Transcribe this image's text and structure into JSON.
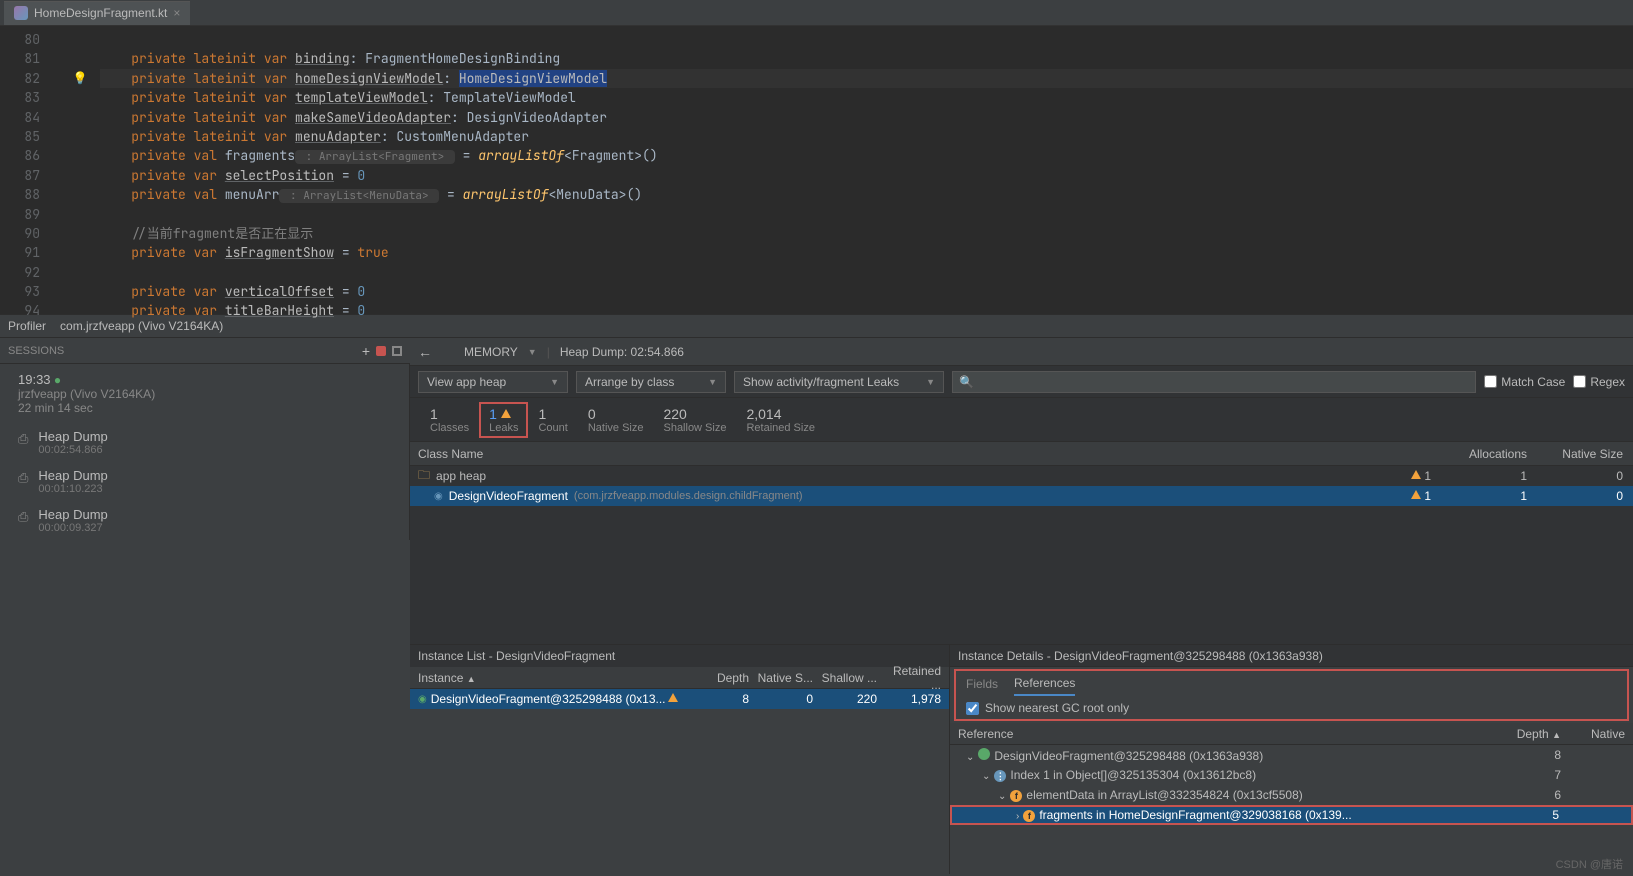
{
  "tab": {
    "filename": "HomeDesignFragment.kt"
  },
  "gutter_start": 80,
  "code_lines": [
    {
      "n": 80,
      "segs": []
    },
    {
      "n": 81,
      "segs": [
        [
          "    ",
          ""
        ],
        [
          "private ",
          "kw"
        ],
        [
          "lateinit ",
          "kw"
        ],
        [
          "var ",
          "kw"
        ],
        [
          "binding",
          "under"
        ],
        [
          ": FragmentHomeDesignBinding",
          "type"
        ]
      ]
    },
    {
      "n": 82,
      "bulb": true,
      "hl": true,
      "segs": [
        [
          "    ",
          ""
        ],
        [
          "private ",
          "kw"
        ],
        [
          "lateinit ",
          "kw"
        ],
        [
          "var ",
          "kw"
        ],
        [
          "homeDesignViewModel",
          "under"
        ],
        [
          ": ",
          "type"
        ],
        [
          "HomeDesignViewModel",
          "caret-sel"
        ]
      ]
    },
    {
      "n": 83,
      "segs": [
        [
          "    ",
          ""
        ],
        [
          "private ",
          "kw"
        ],
        [
          "lateinit ",
          "kw"
        ],
        [
          "var ",
          "kw"
        ],
        [
          "templateViewModel",
          "under"
        ],
        [
          ": TemplateViewModel",
          "type"
        ]
      ]
    },
    {
      "n": 84,
      "segs": [
        [
          "    ",
          ""
        ],
        [
          "private ",
          "kw"
        ],
        [
          "lateinit ",
          "kw"
        ],
        [
          "var ",
          "kw"
        ],
        [
          "makeSameVideoAdapter",
          "under"
        ],
        [
          ": DesignVideoAdapter",
          "type"
        ]
      ]
    },
    {
      "n": 85,
      "segs": [
        [
          "    ",
          ""
        ],
        [
          "private ",
          "kw"
        ],
        [
          "lateinit ",
          "kw"
        ],
        [
          "var ",
          "kw"
        ],
        [
          "menuAdapter",
          "under"
        ],
        [
          ": CustomMenuAdapter",
          "type"
        ]
      ]
    },
    {
      "n": 86,
      "segs": [
        [
          "    ",
          ""
        ],
        [
          "private ",
          "kw"
        ],
        [
          "val ",
          "kw"
        ],
        [
          "fragments",
          "ident"
        ],
        [
          " : ArrayList<Fragment> ",
          "hint"
        ],
        [
          " = ",
          "ident"
        ],
        [
          "arrayListOf",
          "func"
        ],
        [
          "<Fragment>()",
          "ident"
        ]
      ]
    },
    {
      "n": 87,
      "segs": [
        [
          "    ",
          ""
        ],
        [
          "private ",
          "kw"
        ],
        [
          "var ",
          "kw"
        ],
        [
          "selectPosition",
          "under"
        ],
        [
          " = ",
          "ident"
        ],
        [
          "0",
          "lit"
        ]
      ]
    },
    {
      "n": 88,
      "segs": [
        [
          "    ",
          ""
        ],
        [
          "private ",
          "kw"
        ],
        [
          "val ",
          "kw"
        ],
        [
          "menuArr",
          "ident"
        ],
        [
          " : ArrayList<MenuData> ",
          "hint"
        ],
        [
          " = ",
          "ident"
        ],
        [
          "arrayListOf",
          "func"
        ],
        [
          "<MenuData>()",
          "ident"
        ]
      ]
    },
    {
      "n": 89,
      "segs": []
    },
    {
      "n": 90,
      "segs": [
        [
          "    ",
          ""
        ],
        [
          "//当前fragment是否正在显示",
          "comment"
        ]
      ]
    },
    {
      "n": 91,
      "segs": [
        [
          "    ",
          ""
        ],
        [
          "private ",
          "kw"
        ],
        [
          "var ",
          "kw"
        ],
        [
          "isFragmentShow",
          "under"
        ],
        [
          " = ",
          "ident"
        ],
        [
          "true",
          "kw"
        ]
      ]
    },
    {
      "n": 92,
      "segs": []
    },
    {
      "n": 93,
      "segs": [
        [
          "    ",
          ""
        ],
        [
          "private ",
          "kw"
        ],
        [
          "var ",
          "kw"
        ],
        [
          "verticalOffset",
          "under"
        ],
        [
          " = ",
          "ident"
        ],
        [
          "0",
          "lit"
        ]
      ]
    },
    {
      "n": 94,
      "segs": [
        [
          "    ",
          ""
        ],
        [
          "private ",
          "kw"
        ],
        [
          "var ",
          "kw"
        ],
        [
          "titleBarHeight",
          "under"
        ],
        [
          " = ",
          "ident"
        ],
        [
          "0",
          "lit"
        ]
      ]
    }
  ],
  "profiler": {
    "breadcrumb": [
      "Profiler",
      "com.jrzfveapp (Vivo V2164KA)"
    ],
    "sessions_label": "SESSIONS",
    "session": {
      "time": "19:33",
      "device": "jrzfveapp (Vivo V2164KA)",
      "duration": "22 min 14 sec"
    },
    "dumps": [
      {
        "title": "Heap Dump",
        "time": "00:02:54.866"
      },
      {
        "title": "Heap Dump",
        "time": "00:01:10.223"
      },
      {
        "title": "Heap Dump",
        "time": "00:00:09.327"
      }
    ],
    "memory_label": "MEMORY",
    "heap_label": "Heap Dump: 02:54.866",
    "combo1": "View app heap",
    "combo2": "Arrange by class",
    "combo3": "Show activity/fragment Leaks",
    "match_case": "Match Case",
    "regex": "Regex",
    "stats": [
      {
        "num": "1",
        "label": "Classes"
      },
      {
        "num": "1",
        "label": "Leaks",
        "warn": true,
        "boxed": true
      },
      {
        "num": "1",
        "label": "Count"
      },
      {
        "num": "0",
        "label": "Native Size"
      },
      {
        "num": "220",
        "label": "Shallow Size"
      },
      {
        "num": "2,014",
        "label": "Retained Size"
      }
    ],
    "class_cols": [
      "Class Name",
      "Allocations",
      "Native Size"
    ],
    "heap_name": "app heap",
    "class_row": {
      "name": "DesignVideoFragment",
      "pkg": "(com.jrzfveapp.modules.design.childFragment)",
      "warn": "1",
      "alloc": "1",
      "native": "0"
    },
    "heap_row_vals": {
      "warn": "1",
      "alloc": "1",
      "native": "0"
    }
  },
  "instances": {
    "list_title": "Instance List - DesignVideoFragment",
    "cols": [
      "Instance",
      "Depth",
      "Native S...",
      "Shallow ...",
      "Retained ..."
    ],
    "row": {
      "name": "DesignVideoFragment@325298488 (0x13...",
      "depth": "8",
      "native": "0",
      "shallow": "220",
      "retained": "1,978"
    }
  },
  "details": {
    "title": "Instance Details - DesignVideoFragment@325298488 (0x1363a938)",
    "tabs": [
      "Fields",
      "References"
    ],
    "gc_label": "Show nearest GC root only",
    "ref_cols": [
      "Reference",
      "Depth",
      "Native"
    ],
    "refs": [
      {
        "indent": 0,
        "chev": "⌄",
        "icon": "green",
        "text": "DesignVideoFragment@325298488 (0x1363a938)",
        "depth": "8"
      },
      {
        "indent": 1,
        "chev": "⌄",
        "icon": "blue",
        "text": "Index 1 in Object[]@325135304 (0x13612bc8)",
        "depth": "7"
      },
      {
        "indent": 2,
        "chev": "⌄",
        "icon": "orange",
        "text": "elementData in ArrayList@332354824 (0x13cf5508)",
        "depth": "6"
      },
      {
        "indent": 3,
        "chev": "›",
        "icon": "orange",
        "text": "fragments in HomeDesignFragment@329038168 (0x139...",
        "depth": "5",
        "sel": true,
        "red": true
      }
    ]
  },
  "watermark": "CSDN @唐诺"
}
